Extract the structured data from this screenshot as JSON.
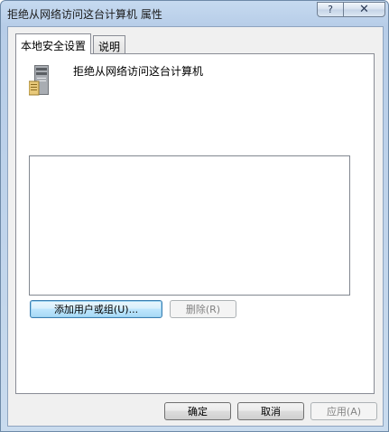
{
  "window": {
    "title": "拒绝从网络访问这台计算机 属性",
    "help_glyph": "?",
    "close_glyph": "✕"
  },
  "tabs": [
    {
      "label": "本地安全设置",
      "active": true
    },
    {
      "label": "说明",
      "active": false
    }
  ],
  "policy": {
    "icon": "computer-tower-icon",
    "name": "拒绝从网络访问这台计算机"
  },
  "accounts_list": [],
  "buttons": {
    "add": "添加用户或组(U)...",
    "remove": "删除(R)",
    "ok": "确定",
    "cancel": "取消",
    "apply": "应用(A)"
  },
  "colors": {
    "title_bar": "#c6daf0",
    "dialog_face": "#f0f0f0",
    "focus_border": "#3c7fb1"
  }
}
